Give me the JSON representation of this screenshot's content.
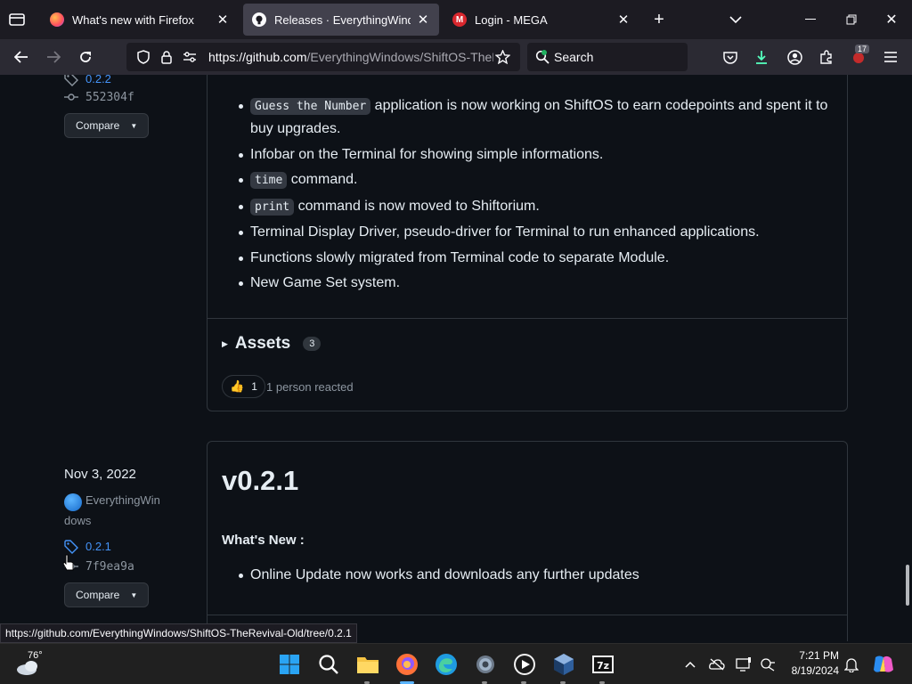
{
  "browser": {
    "tabs": [
      {
        "title": "What's new with Firefox",
        "favicon": "firefox-icon"
      },
      {
        "title": "Releases · EverythingWindows/ShiftOS-TheRevival-Old",
        "favicon": "github-icon",
        "active": true
      },
      {
        "title": "Login - MEGA",
        "favicon": "mega-icon"
      }
    ],
    "url": {
      "host": "https://github.com",
      "path": "/EverythingWindows/ShiftOS-TheRevival-Old/releases"
    },
    "search_placeholder": "Search",
    "extension_badge": "17"
  },
  "release_prev": {
    "tag": "0.2.2",
    "commit": "552304f",
    "compare_label": "Compare",
    "notes": [
      {
        "code": "Guess the Number",
        "text": " application is now working on ShiftOS to earn codepoints and spent it to buy upgrades."
      },
      {
        "code": "",
        "text": "Infobar on the Terminal for showing simple informations."
      },
      {
        "code": "time",
        "text": " command."
      },
      {
        "code": "print",
        "text": " command is now moved to Shiftorium."
      },
      {
        "code": "",
        "text": "Terminal Display Driver, pseudo-driver for Terminal to run enhanced applications."
      },
      {
        "code": "",
        "text": "Functions slowly migrated from Terminal code to separate Module."
      },
      {
        "code": "",
        "text": "New Game Set system."
      }
    ],
    "assets_label": "Assets",
    "assets_count": "3",
    "reaction_emoji": "👍",
    "reaction_count": "1",
    "reaction_text": "1 person reacted"
  },
  "release_current": {
    "date": "Nov 3, 2022",
    "author_line1": "EverythingWin",
    "author_line2": "dows",
    "tag": "0.2.1",
    "commit": "7f9ea9a",
    "compare_label": "Compare",
    "title": "v0.2.1",
    "heading": "What's New :",
    "notes": [
      "Online Update now works and downloads any further updates"
    ]
  },
  "status_link": "https://github.com/EverythingWindows/ShiftOS-TheRevival-Old/tree/0.2.1",
  "taskbar": {
    "weather": "76°",
    "time": "7:21 PM",
    "date": "8/19/2024"
  },
  "colors": {
    "page_bg": "#0d1117",
    "text": "#e6edf3",
    "muted": "#8d96a0",
    "link": "#4493f8",
    "border": "#30363d"
  }
}
